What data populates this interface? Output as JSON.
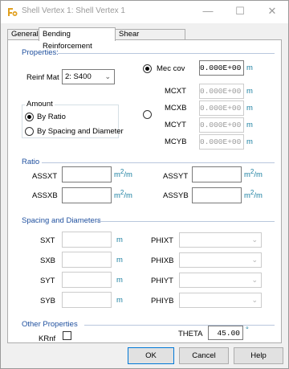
{
  "window": {
    "title": "Shell Vertex 1: Shell Vertex 1"
  },
  "window_buttons": {
    "minimize": "—",
    "maximize": "☐",
    "close": "✕"
  },
  "tabs": [
    "General",
    "Bending Reinforcement",
    "Shear Reinforcement"
  ],
  "active_tab": "Bending Reinforcement",
  "properties": {
    "section_label": "Properties:",
    "reinf_mat_label": "Reinf Mat",
    "reinf_mat_value": "2: S400",
    "amount_group_label": "Amount",
    "by_ratio_label": "By Ratio",
    "by_spacing_label": "By Spacing and Diameter",
    "by_ratio_selected": true,
    "mec_cov_label": "Mec cov",
    "mec_cov_value": "0.000E+00",
    "mec_cov_unit": "m",
    "mec_cov_selected": true,
    "fields": [
      {
        "label": "MCXT",
        "value": "0.000E+00",
        "unit": "m"
      },
      {
        "label": "MCXB",
        "value": "0.000E+00",
        "unit": "m"
      },
      {
        "label": "MCYT",
        "value": "0.000E+00",
        "unit": "m"
      },
      {
        "label": "MCYB",
        "value": "0.000E+00",
        "unit": "m"
      }
    ]
  },
  "ratio": {
    "section_label": "Ratio",
    "unit_base": "m",
    "unit_exp": "2",
    "unit_tail": "/m",
    "assxt_label": "ASSXT",
    "assxb_label": "ASSXB",
    "assyt_label": "ASSYT",
    "assyb_label": "ASSYB"
  },
  "spacing": {
    "section_label": "Spacing and Diameters",
    "unit": "m",
    "sxt_label": "SXT",
    "sxb_label": "SXB",
    "syt_label": "SYT",
    "syb_label": "SYB",
    "phixt_label": "PHIXT",
    "phixb_label": "PHIXB",
    "phiyt_label": "PHIYT",
    "phiyb_label": "PHIYB"
  },
  "other": {
    "section_label": "Other Properties",
    "krnf_label": "KRnf",
    "theta_label": "THETA",
    "theta_value": "45.00",
    "theta_unit": "°"
  },
  "buttons": {
    "ok": "OK",
    "cancel": "Cancel",
    "help": "Help"
  },
  "colors": {
    "section": "#1e4f9e",
    "unit": "#1a7fa0",
    "accent": "#0078d7"
  }
}
